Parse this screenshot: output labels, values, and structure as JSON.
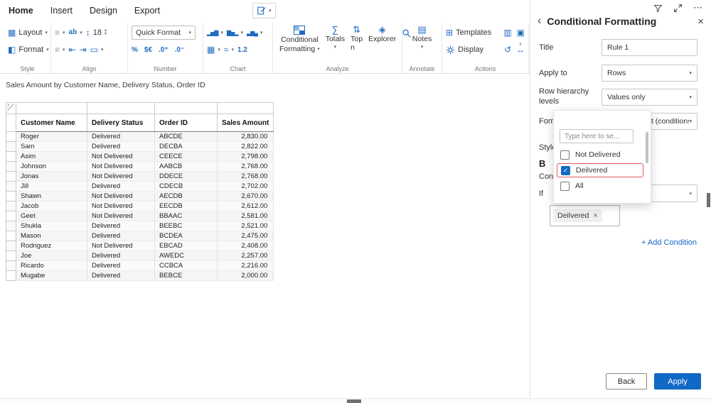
{
  "ribbon": {
    "tabs": [
      {
        "label": "Home",
        "active": true
      },
      {
        "label": "Insert",
        "active": false
      },
      {
        "label": "Design",
        "active": false
      },
      {
        "label": "Export",
        "active": false
      }
    ],
    "groups": {
      "style": {
        "label": "Style",
        "layout": "Layout",
        "format": "Format"
      },
      "align": {
        "label": "Align",
        "wrap": "ab",
        "font_size": "18"
      },
      "number": {
        "label": "Number",
        "quick_format": "Quick Format"
      },
      "chart": {
        "label": "Chart",
        "number_fmt": "1.2"
      },
      "analyze": {
        "label": "Analyze",
        "cf_line1": "Conditional",
        "cf_line2": "Formatting",
        "totals": "Totals",
        "top_n": "Top n",
        "explorer": "Explorer"
      },
      "annotate": {
        "label": "Annotate",
        "notes": "Notes"
      },
      "actions": {
        "label": "Actions",
        "templates": "Templates",
        "display": "Display"
      }
    }
  },
  "canvas": {
    "report_title": "Sales Amount by Customer Name, Delivery Status, Order ID",
    "table": {
      "columns": [
        "Customer Name",
        "Delivery Status",
        "Order ID",
        "Sales Amount"
      ],
      "rows": [
        [
          "Roger",
          "Delivered",
          "ABCDE",
          "2,830.00"
        ],
        [
          "Sam",
          "Delivered",
          "DECBA",
          "2,822.00"
        ],
        [
          "Asim",
          "Not Delivered",
          "CEECE",
          "2,798.00"
        ],
        [
          "Johnson",
          "Not Delivered",
          "AABCB",
          "2,768.00"
        ],
        [
          "Jonas",
          "Not Delivered",
          "DDECE",
          "2,768.00"
        ],
        [
          "Jill",
          "Delivered",
          "CDECB",
          "2,702.00"
        ],
        [
          "Shawn",
          "Not Delivered",
          "AECDB",
          "2,670.00"
        ],
        [
          "Jacob",
          "Not Delivered",
          "EECDB",
          "2,612.00"
        ],
        [
          "Geet",
          "Not Delivered",
          "BBAAC",
          "2,581.00"
        ],
        [
          "Shukla",
          "Delivered",
          "BEEBC",
          "2,521.00"
        ],
        [
          "Mason",
          "Delivered",
          "BCDEA",
          "2,475.00"
        ],
        [
          "Rodriguez",
          "Not Delivered",
          "EBCAD",
          "2,408.00"
        ],
        [
          "Joe",
          "Delivered",
          "AWEDC",
          "2,257.00"
        ],
        [
          "Ricardo",
          "Delivered",
          "CCBCA",
          "2,216.00"
        ],
        [
          "Mugabe",
          "Delivered",
          "BEBCE",
          "2,000.00"
        ]
      ]
    }
  },
  "panel": {
    "title": "Conditional Formatting",
    "fields": {
      "title_label": "Title",
      "title_value": "Rule 1",
      "apply_to_label": "Apply to",
      "apply_to_value": "Rows",
      "row_hierarchy_label": "Row hierarchy levels",
      "row_hierarchy_value": "Values only",
      "format_label": "Format",
      "format_value": "Sales Amount (conditions)",
      "style_label": "Style",
      "bold": "B",
      "conditions_label": "Conditions",
      "if_label": "If"
    },
    "popup": {
      "search_placeholder": "Type here to se...",
      "options": [
        {
          "label": "Not Delivered",
          "checked": false,
          "highlight": false
        },
        {
          "label": "Deilvered",
          "checked": true,
          "highlight": true
        },
        {
          "label": "All",
          "checked": false,
          "highlight": false
        }
      ]
    },
    "chip": {
      "label": "Deilvered"
    },
    "add_condition": "+ Add Condition",
    "back": "Back",
    "apply": "Apply"
  },
  "colors": {
    "accent": "#1168c6",
    "icon-blue": "#1f6bc0",
    "highlight-red": "#e05a5f"
  },
  "icons": {
    "chevron_down": "▾",
    "back": "‹",
    "collapse": "›",
    "close": "×",
    "ellipsis": "⋯",
    "check": "✓",
    "remove": "×",
    "layout": "▦",
    "format_brush": "◧",
    "align_lines": "≡",
    "line_height": "↕",
    "spin_up": "▴",
    "spin_down": "▾",
    "indent_left": "⇤",
    "indent_right": "⇥",
    "border": "▭",
    "percent": "%",
    "currency": "$€",
    "decimal_inc": ".0⁺",
    "decimal_dec": ".0⁻",
    "bar_chart": "▂▅▇",
    "column_chart": "▇▅▂",
    "combo_chart": "▃▆▄",
    "table_icon": "▦",
    "sparkline": "≈",
    "totals": "∑",
    "top_n": "⇅",
    "explorer": "◈",
    "notes": "▤",
    "templates": "⊞",
    "columns2": "▥",
    "box": "▣",
    "undo": "↺",
    "resize": "↔"
  }
}
